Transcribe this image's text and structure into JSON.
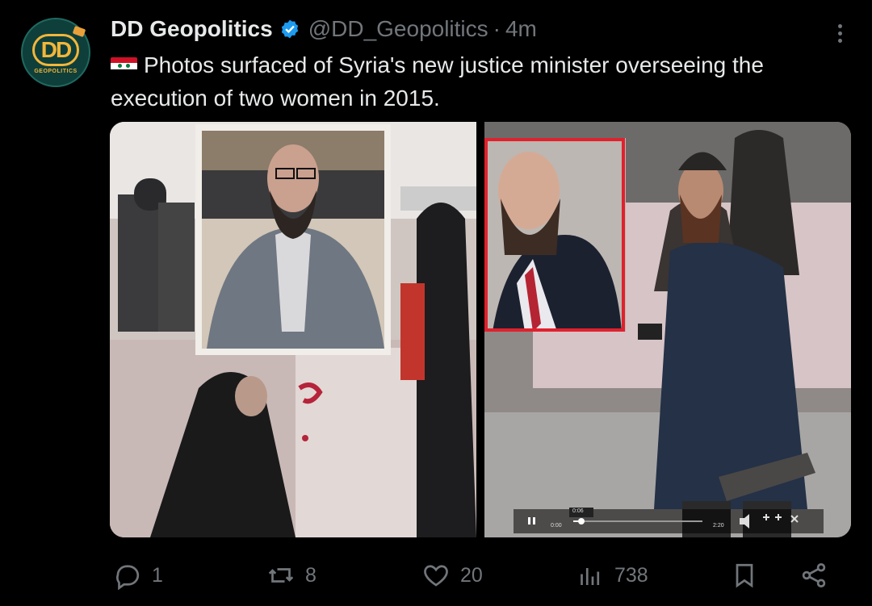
{
  "post": {
    "author_name": "DD Geopolitics",
    "handle": "@DD_Geopolitics",
    "separator": "·",
    "time": "4m",
    "text": "Photos surfaced of Syria's new justice minister overseeing the execution of two women in 2015.",
    "flag_icon": "syria-flag-icon",
    "avatar_letters": "DD",
    "avatar_subtitle": "GEOPOLITICS"
  },
  "media": {
    "video_timestamp": "0:00",
    "video_duration": "2:20",
    "video_hover_time": "0:06"
  },
  "actions": {
    "replies": "1",
    "reposts": "8",
    "likes": "20",
    "views": "738"
  },
  "colors": {
    "background": "#000000",
    "primary_text": "#e7e9ea",
    "secondary_text": "#71767b",
    "verified_blue": "#1d9bf0"
  }
}
